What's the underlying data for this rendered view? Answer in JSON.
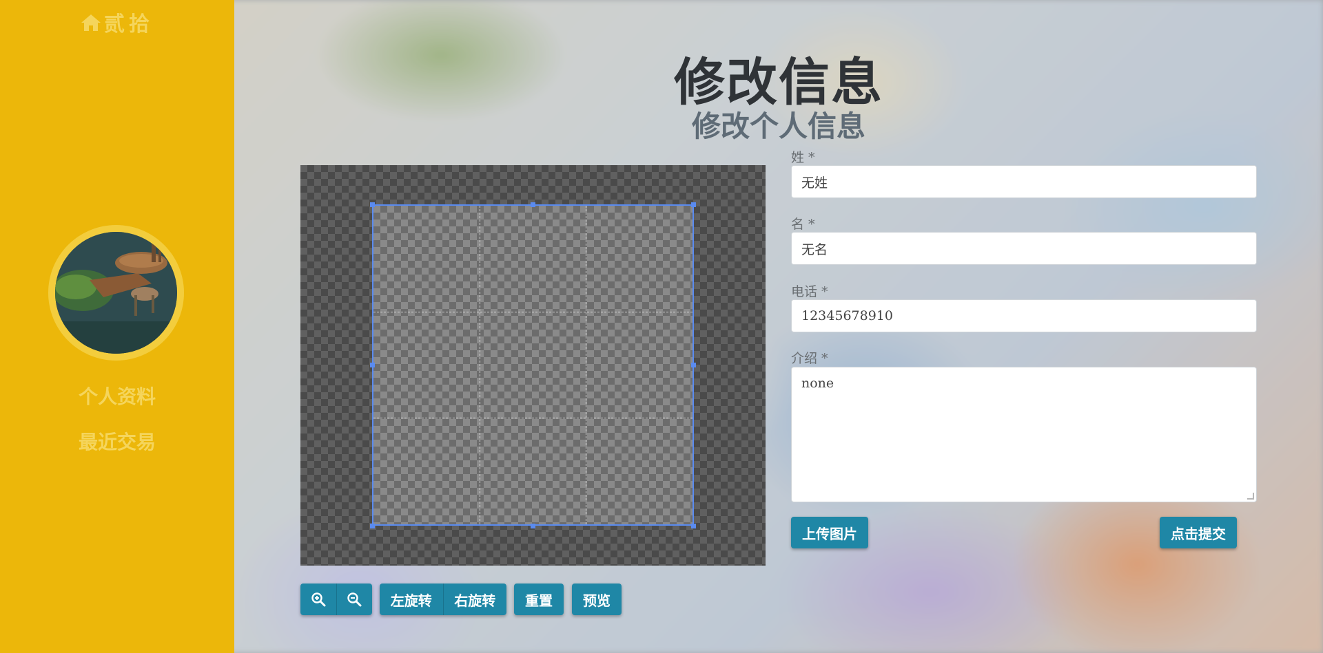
{
  "sidebar": {
    "brand": "贰拾",
    "nav": [
      {
        "label": "个人资料"
      },
      {
        "label": "最近交易"
      }
    ]
  },
  "header": {
    "title": "修改信息",
    "subtitle": "修改个人信息"
  },
  "cropper_toolbar": {
    "zoom_in_icon": "zoom-in-icon",
    "zoom_out_icon": "zoom-out-icon",
    "rotate_left": "左旋转",
    "rotate_right": "右旋转",
    "reset": "重置",
    "preview": "预览"
  },
  "form": {
    "last_name": {
      "label": "姓 *",
      "value": "无姓"
    },
    "first_name": {
      "label": "名 *",
      "value": "无名"
    },
    "phone": {
      "label": "电话 *",
      "value": "12345678910"
    },
    "intro": {
      "label": "介绍 *",
      "value": "none"
    },
    "upload_label": "上传图片",
    "submit_label": "点击提交"
  },
  "colors": {
    "sidebar": "#ecb70a",
    "sidebar_text": "#f5d55c",
    "button": "#1f87a6",
    "crop_border": "#5a8bf0"
  }
}
